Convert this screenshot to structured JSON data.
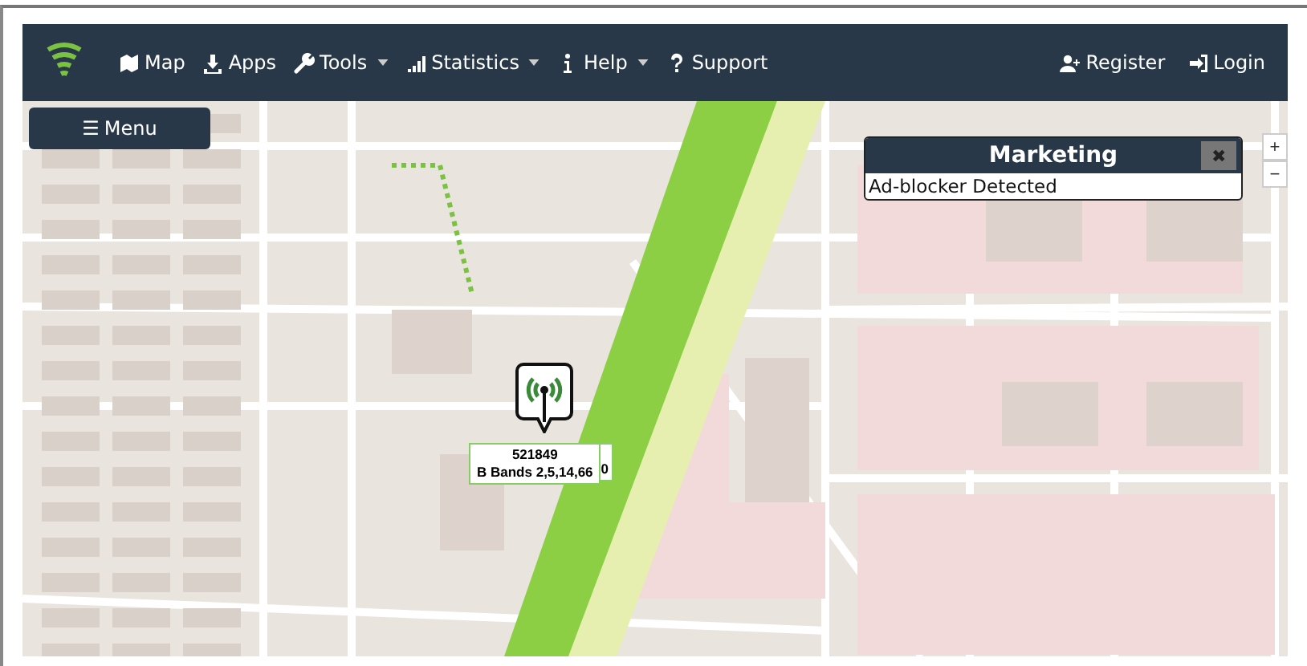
{
  "navbar": {
    "items": [
      {
        "label": "Map",
        "dropdown": false
      },
      {
        "label": "Apps",
        "dropdown": false
      },
      {
        "label": "Tools",
        "dropdown": true
      },
      {
        "label": "Statistics",
        "dropdown": true
      },
      {
        "label": "Help",
        "dropdown": true
      },
      {
        "label": "Support",
        "dropdown": false
      }
    ],
    "right_items": [
      {
        "label": "Register"
      },
      {
        "label": "Login"
      }
    ]
  },
  "menu_button": {
    "icon": "☰",
    "label": "Menu"
  },
  "popup": {
    "title": "Marketing",
    "close": "✖",
    "message": "Ad-blocker Detected"
  },
  "zoom_controls": [
    "+",
    "−"
  ],
  "marker": {
    "id": "521849",
    "bands": "B Bands 2,5,14,66",
    "overlap": "0"
  }
}
